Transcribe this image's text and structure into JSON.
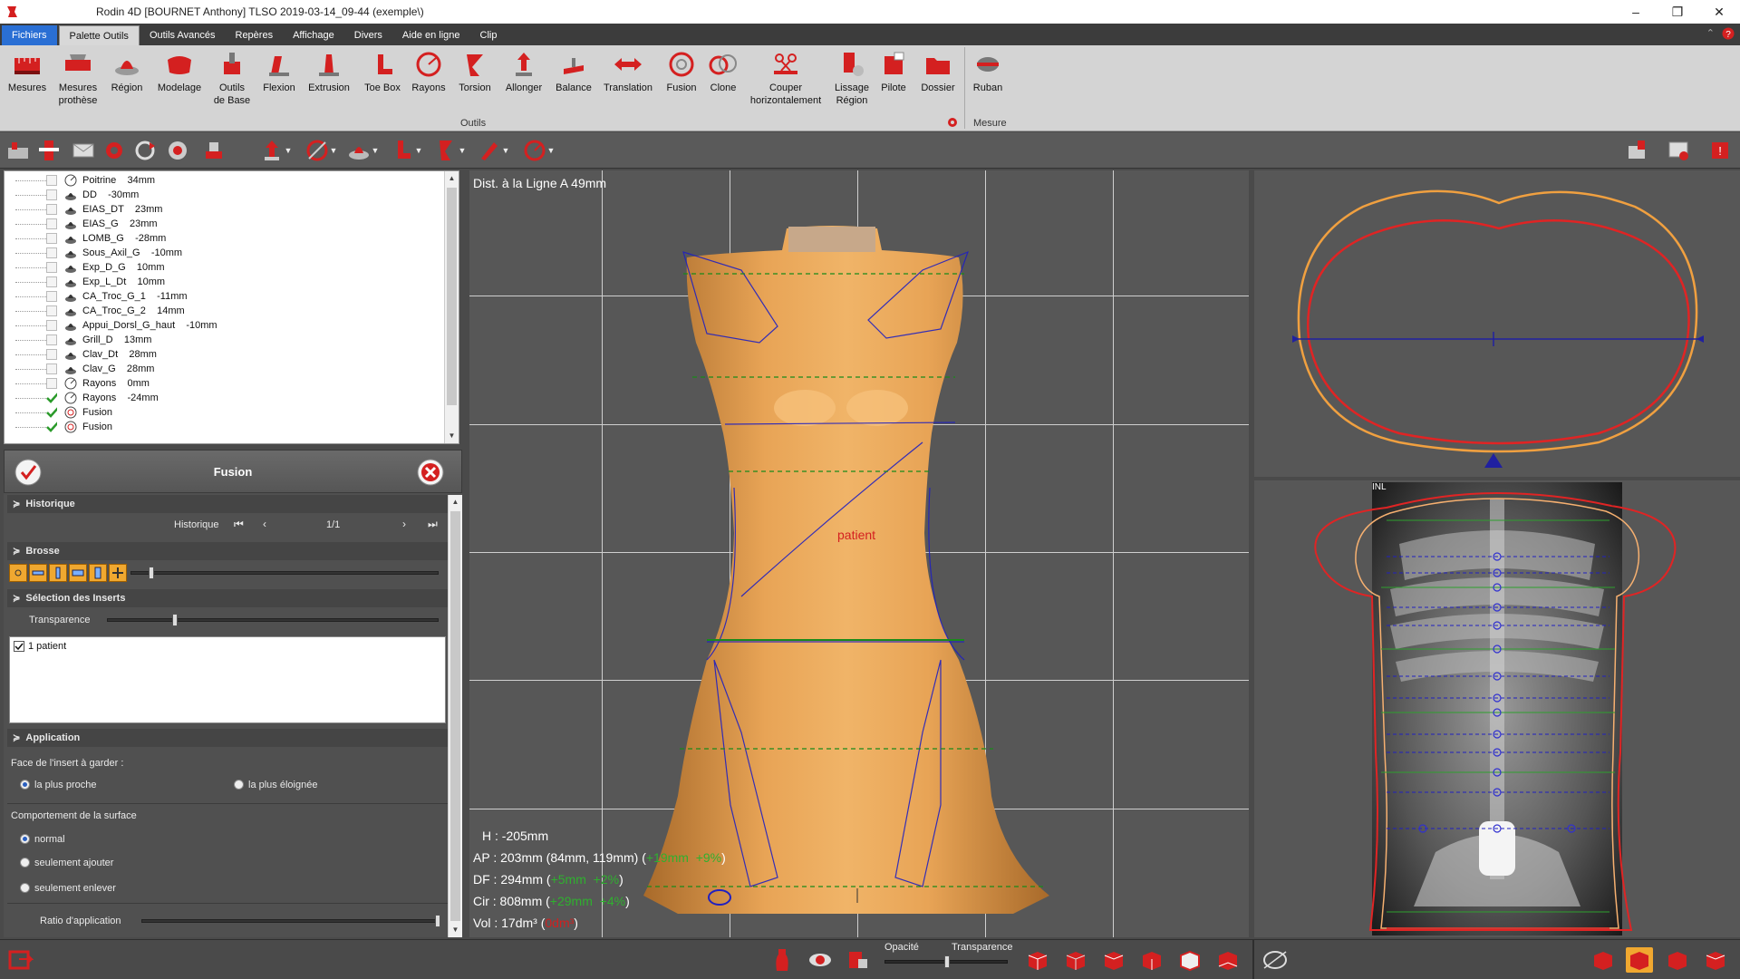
{
  "window": {
    "title": "Rodin 4D [BOURNET Anthony] TLSO 2019-03-14_09-44 (exemple\\)",
    "minimize": "–",
    "restore": "❐",
    "close": "✕"
  },
  "ribbon_tabs": [
    {
      "label": "Fichiers"
    },
    {
      "label": "Palette Outils"
    },
    {
      "label": "Outils Avancés"
    },
    {
      "label": "Repères"
    },
    {
      "label": "Affichage"
    },
    {
      "label": "Divers"
    },
    {
      "label": "Aide en ligne"
    },
    {
      "label": "Clip"
    }
  ],
  "ribbon": {
    "buttons": [
      {
        "label": "Mesures"
      },
      {
        "label": "Mesures\nprothèse"
      },
      {
        "label": "Région"
      },
      {
        "label": "Modelage"
      },
      {
        "label": "Outils\nde Base"
      },
      {
        "label": "Flexion"
      },
      {
        "label": "Extrusion"
      },
      {
        "label": "Toe Box"
      },
      {
        "label": "Rayons"
      },
      {
        "label": "Torsion"
      },
      {
        "label": "Allonger"
      },
      {
        "label": "Balance"
      },
      {
        "label": "Translation"
      },
      {
        "label": "Fusion"
      },
      {
        "label": "Clone"
      },
      {
        "label": "Couper\nhorizontalement"
      },
      {
        "label": "Lissage\nRégion"
      },
      {
        "label": "Pilote"
      },
      {
        "label": "Dossier"
      },
      {
        "label": "Ruban"
      }
    ],
    "group_outils": "Outils",
    "group_mesure": "Mesure"
  },
  "tree": {
    "items": [
      {
        "label": "Poitrine    34mm",
        "checked": false,
        "icon": "rayons"
      },
      {
        "label": "DD    -30mm",
        "checked": false,
        "icon": "tool"
      },
      {
        "label": "EIAS_DT    23mm",
        "checked": false,
        "icon": "tool"
      },
      {
        "label": "EIAS_G    23mm",
        "checked": false,
        "icon": "tool"
      },
      {
        "label": "LOMB_G    -28mm",
        "checked": false,
        "icon": "tool"
      },
      {
        "label": "Sous_Axil_G    -10mm",
        "checked": false,
        "icon": "tool"
      },
      {
        "label": "Exp_D_G    10mm",
        "checked": false,
        "icon": "tool"
      },
      {
        "label": "Exp_L_Dt    10mm",
        "checked": false,
        "icon": "tool"
      },
      {
        "label": "CA_Troc_G_1    -11mm",
        "checked": false,
        "icon": "tool"
      },
      {
        "label": "CA_Troc_G_2    14mm",
        "checked": false,
        "icon": "tool"
      },
      {
        "label": "Appui_Dorsl_G_haut    -10mm",
        "checked": false,
        "icon": "tool"
      },
      {
        "label": "Grill_D    13mm",
        "checked": false,
        "icon": "tool"
      },
      {
        "label": "Clav_Dt    28mm",
        "checked": false,
        "icon": "tool"
      },
      {
        "label": "Clav_G    28mm",
        "checked": false,
        "icon": "tool"
      },
      {
        "label": "Rayons    0mm",
        "checked": false,
        "icon": "rayons"
      },
      {
        "label": "Rayons    -24mm",
        "checked": true,
        "icon": "rayons"
      },
      {
        "label": "Fusion",
        "checked": true,
        "icon": "fusion"
      },
      {
        "label": "Fusion",
        "checked": true,
        "icon": "fusion"
      }
    ]
  },
  "props": {
    "title": "Fusion",
    "historique": {
      "section": "Historique",
      "label": "Historique",
      "page": "1/1"
    },
    "brosse": {
      "section": "Brosse"
    },
    "inserts": {
      "section": "Sélection des Inserts",
      "transparence_label": "Transparence",
      "transparence_level": 0.2,
      "list": [
        "1 patient"
      ]
    },
    "application": {
      "section": "Application",
      "face_label": "Face de l'insert à garder :",
      "face_options": [
        "la plus proche",
        "la plus éloignée"
      ],
      "face_selected": 0,
      "surface_label": "Comportement de la surface",
      "surface_options": [
        "normal",
        "seulement ajouter",
        "seulement enlever"
      ],
      "surface_selected": 0,
      "ratio_label": "Ratio d'application",
      "ratio_level": 1.0
    }
  },
  "viewport": {
    "dist_text": "Dist. à la Ligne A 49mm",
    "patient_label": "patient",
    "measures": {
      "h": "H : -205mm",
      "ap_prefix": "AP : 203mm (84mm, 119mm) (",
      "ap_green": "+19mm  +9%",
      "ap_suffix": ")",
      "df_prefix": "DF : 294mm (",
      "df_green": "+5mm  +2%",
      "df_suffix": ")",
      "cir_prefix": "Cir : 808mm (",
      "cir_green": "+29mm  +4%",
      "cir_suffix": ")",
      "vol_prefix": "Vol : 17dm³ (",
      "vol_red": "0dm³",
      "vol_suffix": ")"
    }
  },
  "xray": {
    "label": "INL"
  },
  "statusbar": {
    "opacite_label": "Opacité",
    "transparence_label": "Transparence"
  },
  "colors": {
    "accent_blue": "#2a6fd4",
    "skin": "#d99a4e",
    "outline_red": "#e02424",
    "outline_orange": "#f0a040",
    "guide_blue": "#2020c0"
  }
}
